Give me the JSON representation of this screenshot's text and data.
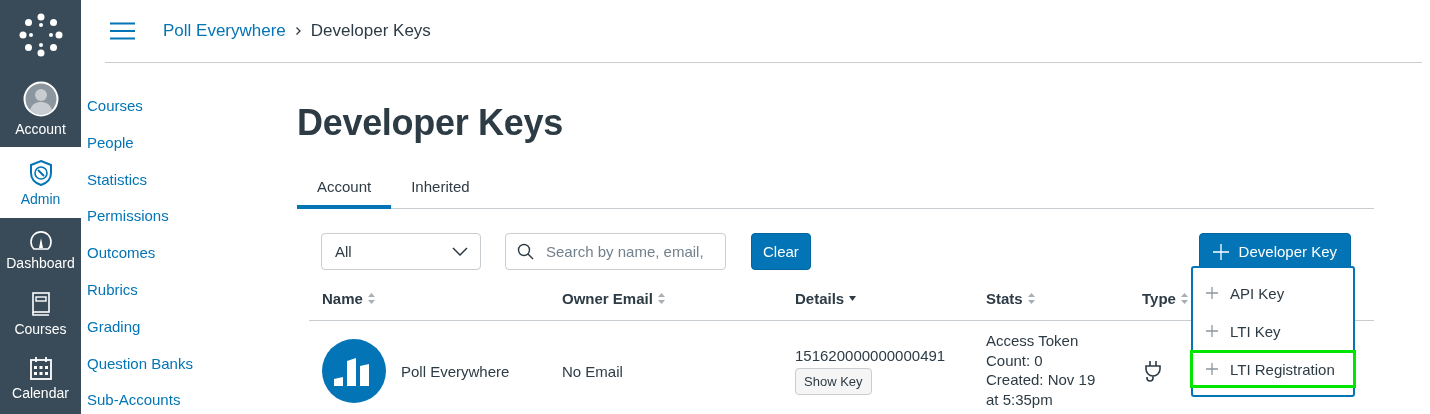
{
  "global_nav": [
    {
      "label": "Account",
      "kind": "avatar",
      "selected": false
    },
    {
      "label": "Admin",
      "kind": "admin",
      "selected": true
    },
    {
      "label": "Dashboard",
      "kind": "dashboard",
      "selected": false
    },
    {
      "label": "Courses",
      "kind": "courses",
      "selected": false
    },
    {
      "label": "Calendar",
      "kind": "calendar",
      "selected": false
    }
  ],
  "breadcrumbs": [
    "Poll Everywhere",
    "Developer Keys"
  ],
  "account_nav": [
    "Courses",
    "People",
    "Statistics",
    "Permissions",
    "Outcomes",
    "Rubrics",
    "Grading",
    "Question Banks",
    "Sub-Accounts"
  ],
  "page_title": "Developer Keys",
  "tabs": [
    {
      "label": "Account",
      "selected": true
    },
    {
      "label": "Inherited",
      "selected": false
    }
  ],
  "filter": {
    "value": "All"
  },
  "search": {
    "placeholder": "Search by name, email,"
  },
  "clear_button": "Clear",
  "add_button": "Developer Key",
  "add_menu": [
    {
      "label": "API Key",
      "highlighted": false
    },
    {
      "label": "LTI Key",
      "highlighted": false
    },
    {
      "label": "LTI Registration",
      "highlighted": true
    }
  ],
  "table": {
    "columns": [
      {
        "label": "Name",
        "sorted_descending": false
      },
      {
        "label": "Owner Email",
        "sorted_descending": false
      },
      {
        "label": "Details",
        "sorted_descending": true
      },
      {
        "label": "Stats",
        "sorted_descending": false
      },
      {
        "label": "Type",
        "sorted_descending": false
      }
    ],
    "rows": [
      {
        "name": "Poll Everywhere",
        "owner_email": "No Email",
        "key_id": "151620000000000491",
        "show_key_button": "Show Key",
        "stats": [
          "Access Token",
          "Count: 0",
          "Created: Nov 19",
          "at 5:35pm"
        ],
        "kind": "lti"
      }
    ]
  }
}
